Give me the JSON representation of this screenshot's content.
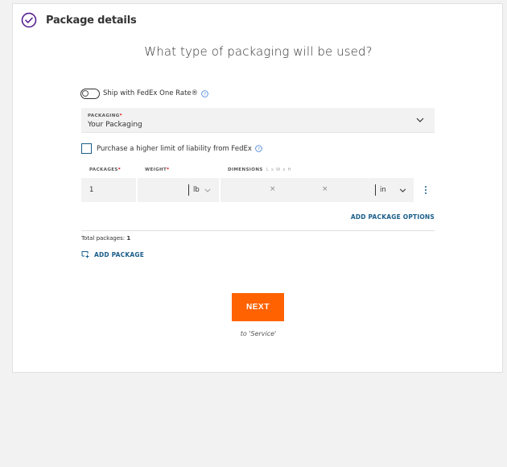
{
  "section": {
    "title": "Package details",
    "completed_icon": "check-circle-icon",
    "accent": "#4d148c"
  },
  "question": "What type of packaging will be used?",
  "one_rate": {
    "label": "Ship with FedEx One Rate®",
    "enabled": false
  },
  "packaging": {
    "label": "PACKAGING",
    "required_mark": "*",
    "value": "Your Packaging"
  },
  "liability": {
    "label": "Purchase a higher limit of liability from FedEx",
    "checked": false
  },
  "package_table": {
    "headers": {
      "packages": "PACKAGES",
      "weight": "WEIGHT",
      "dimensions": "DIMENSIONS",
      "dimensions_hint": "L x W x H",
      "required_mark": "*"
    },
    "row": {
      "packages": "1",
      "weight": "",
      "weight_unit": "lb",
      "length": "",
      "width": "",
      "height": "",
      "dim_separator": "×",
      "dim_unit": "in"
    }
  },
  "add_package_options": "ADD PACKAGE OPTIONS",
  "total": {
    "label": "Total packages:",
    "value": "1"
  },
  "add_package": "ADD PACKAGE",
  "next": {
    "label": "NEXT",
    "subtext": "to 'Service'"
  },
  "colors": {
    "primary_button": "#ff6200",
    "link": "#1a5e8a",
    "help": "#3a7bd5"
  }
}
